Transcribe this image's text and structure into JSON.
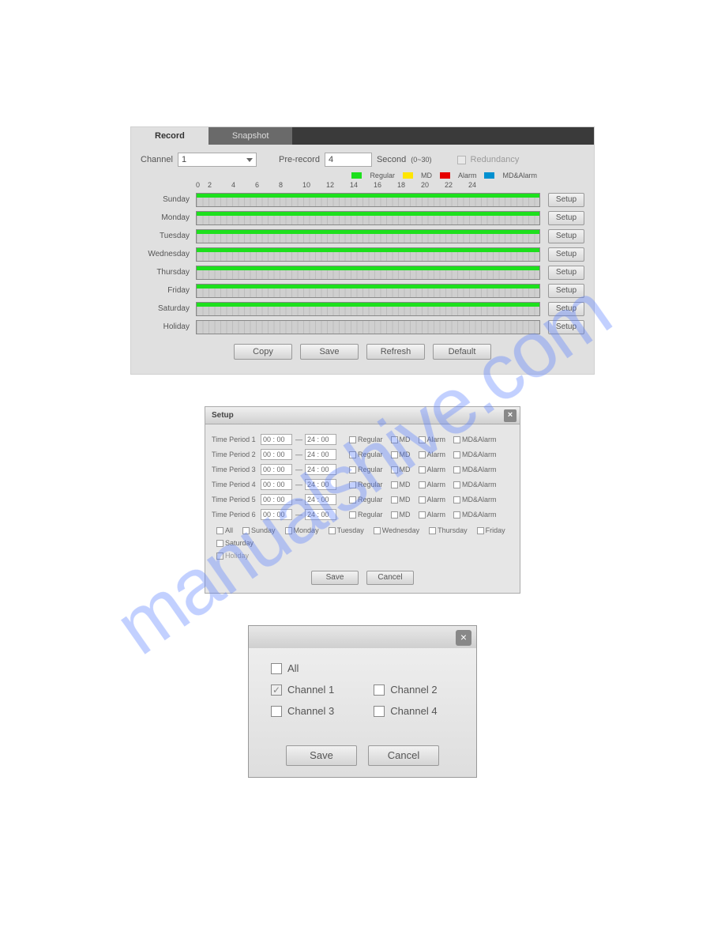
{
  "watermark": "manualshive.com",
  "panel1": {
    "tabs": {
      "record": "Record",
      "snapshot": "Snapshot"
    },
    "channel_label": "Channel",
    "channel_value": "1",
    "prerecord_label": "Pre-record",
    "prerecord_value": "4",
    "second_label": "Second",
    "second_range": "(0~30)",
    "redundancy_label": "Redundancy",
    "legend": {
      "regular": "Regular",
      "md": "MD",
      "alarm": "Alarm",
      "mdalarm": "MD&Alarm"
    },
    "ticks": [
      "0",
      "2",
      "4",
      "6",
      "8",
      "10",
      "12",
      "14",
      "16",
      "18",
      "20",
      "22",
      "24"
    ],
    "days": [
      {
        "name": "Sunday",
        "bar": true
      },
      {
        "name": "Monday",
        "bar": true
      },
      {
        "name": "Tuesday",
        "bar": true
      },
      {
        "name": "Wednesday",
        "bar": true
      },
      {
        "name": "Thursday",
        "bar": true
      },
      {
        "name": "Friday",
        "bar": true
      },
      {
        "name": "Saturday",
        "bar": true
      },
      {
        "name": "Holiday",
        "bar": false
      }
    ],
    "setup_label": "Setup",
    "buttons": {
      "copy": "Copy",
      "save": "Save",
      "refresh": "Refresh",
      "default": "Default"
    }
  },
  "panel2": {
    "title": "Setup",
    "period_label_prefix": "Time Period ",
    "periods": [
      {
        "from": "00 : 00",
        "to": "24 : 00"
      },
      {
        "from": "00 : 00",
        "to": "24 : 00"
      },
      {
        "from": "00 : 00",
        "to": "24 : 00"
      },
      {
        "from": "00 : 00",
        "to": "24 : 00"
      },
      {
        "from": "00 : 00",
        "to": "24 : 00"
      },
      {
        "from": "00 : 00",
        "to": "24 : 00"
      }
    ],
    "types": {
      "regular": "Regular",
      "md": "MD",
      "alarm": "Alarm",
      "mdalarm": "MD&Alarm"
    },
    "days": {
      "all": "All",
      "sun": "Sunday",
      "mon": "Monday",
      "tue": "Tuesday",
      "wed": "Wednesday",
      "thu": "Thursday",
      "fri": "Friday",
      "sat": "Saturday",
      "hol": "Holiday"
    },
    "buttons": {
      "save": "Save",
      "cancel": "Cancel"
    }
  },
  "panel3": {
    "all": "All",
    "channels": {
      "c1": "Channel 1",
      "c2": "Channel 2",
      "c3": "Channel 3",
      "c4": "Channel 4"
    },
    "buttons": {
      "save": "Save",
      "cancel": "Cancel"
    }
  }
}
